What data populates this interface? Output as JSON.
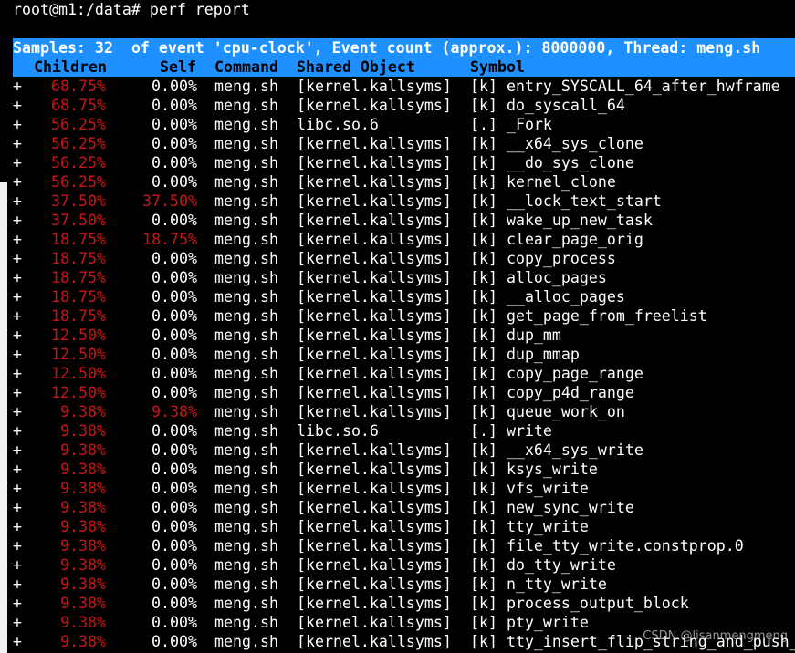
{
  "terminal": {
    "prompt": "root@m1:/data# perf report",
    "header_line": "Samples: 32  of event 'cpu-clock', Event count (approx.): 8000000, Thread: meng.sh",
    "columns": {
      "children": "Children",
      "self": "Self",
      "command": "Command",
      "shared_object": "Shared Object",
      "symbol": "Symbol"
    },
    "colors": {
      "header_bg": "#1e90ff",
      "hot_percent": "#cc1414",
      "background": "#000000",
      "text": "#ffffff"
    }
  },
  "rows": [
    {
      "plus": "+",
      "children": "68.75%",
      "self": "0.00%",
      "command": "meng.sh",
      "object": "[kernel.kallsyms]",
      "symbol": "[k] entry_SYSCALL_64_after_hwframe",
      "children_hot": true,
      "self_hot": false
    },
    {
      "plus": "+",
      "children": "68.75%",
      "self": "0.00%",
      "command": "meng.sh",
      "object": "[kernel.kallsyms]",
      "symbol": "[k] do_syscall_64",
      "children_hot": true,
      "self_hot": false
    },
    {
      "plus": "+",
      "children": "56.25%",
      "self": "0.00%",
      "command": "meng.sh",
      "object": "libc.so.6",
      "symbol": "[.] _Fork",
      "children_hot": true,
      "self_hot": false
    },
    {
      "plus": "+",
      "children": "56.25%",
      "self": "0.00%",
      "command": "meng.sh",
      "object": "[kernel.kallsyms]",
      "symbol": "[k] __x64_sys_clone",
      "children_hot": true,
      "self_hot": false
    },
    {
      "plus": "+",
      "children": "56.25%",
      "self": "0.00%",
      "command": "meng.sh",
      "object": "[kernel.kallsyms]",
      "symbol": "[k] __do_sys_clone",
      "children_hot": true,
      "self_hot": false
    },
    {
      "plus": "+",
      "children": "56.25%",
      "self": "0.00%",
      "command": "meng.sh",
      "object": "[kernel.kallsyms]",
      "symbol": "[k] kernel_clone",
      "children_hot": true,
      "self_hot": false
    },
    {
      "plus": "+",
      "children": "37.50%",
      "self": "37.50%",
      "command": "meng.sh",
      "object": "[kernel.kallsyms]",
      "symbol": "[k] __lock_text_start",
      "children_hot": true,
      "self_hot": true
    },
    {
      "plus": "+",
      "children": "37.50%",
      "self": "0.00%",
      "command": "meng.sh",
      "object": "[kernel.kallsyms]",
      "symbol": "[k] wake_up_new_task",
      "children_hot": true,
      "self_hot": false
    },
    {
      "plus": "+",
      "children": "18.75%",
      "self": "18.75%",
      "command": "meng.sh",
      "object": "[kernel.kallsyms]",
      "symbol": "[k] clear_page_orig",
      "children_hot": true,
      "self_hot": true
    },
    {
      "plus": "+",
      "children": "18.75%",
      "self": "0.00%",
      "command": "meng.sh",
      "object": "[kernel.kallsyms]",
      "symbol": "[k] copy_process",
      "children_hot": true,
      "self_hot": false
    },
    {
      "plus": "+",
      "children": "18.75%",
      "self": "0.00%",
      "command": "meng.sh",
      "object": "[kernel.kallsyms]",
      "symbol": "[k] alloc_pages",
      "children_hot": true,
      "self_hot": false
    },
    {
      "plus": "+",
      "children": "18.75%",
      "self": "0.00%",
      "command": "meng.sh",
      "object": "[kernel.kallsyms]",
      "symbol": "[k] __alloc_pages",
      "children_hot": true,
      "self_hot": false
    },
    {
      "plus": "+",
      "children": "18.75%",
      "self": "0.00%",
      "command": "meng.sh",
      "object": "[kernel.kallsyms]",
      "symbol": "[k] get_page_from_freelist",
      "children_hot": true,
      "self_hot": false
    },
    {
      "plus": "+",
      "children": "12.50%",
      "self": "0.00%",
      "command": "meng.sh",
      "object": "[kernel.kallsyms]",
      "symbol": "[k] dup_mm",
      "children_hot": true,
      "self_hot": false
    },
    {
      "plus": "+",
      "children": "12.50%",
      "self": "0.00%",
      "command": "meng.sh",
      "object": "[kernel.kallsyms]",
      "symbol": "[k] dup_mmap",
      "children_hot": true,
      "self_hot": false
    },
    {
      "plus": "+",
      "children": "12.50%",
      "self": "0.00%",
      "command": "meng.sh",
      "object": "[kernel.kallsyms]",
      "symbol": "[k] copy_page_range",
      "children_hot": true,
      "self_hot": false
    },
    {
      "plus": "+",
      "children": "12.50%",
      "self": "0.00%",
      "command": "meng.sh",
      "object": "[kernel.kallsyms]",
      "symbol": "[k] copy_p4d_range",
      "children_hot": true,
      "self_hot": false
    },
    {
      "plus": "+",
      "children": "9.38%",
      "self": "9.38%",
      "command": "meng.sh",
      "object": "[kernel.kallsyms]",
      "symbol": "[k] queue_work_on",
      "children_hot": true,
      "self_hot": true
    },
    {
      "plus": "+",
      "children": "9.38%",
      "self": "0.00%",
      "command": "meng.sh",
      "object": "libc.so.6",
      "symbol": "[.] write",
      "children_hot": true,
      "self_hot": false
    },
    {
      "plus": "+",
      "children": "9.38%",
      "self": "0.00%",
      "command": "meng.sh",
      "object": "[kernel.kallsyms]",
      "symbol": "[k] __x64_sys_write",
      "children_hot": true,
      "self_hot": false
    },
    {
      "plus": "+",
      "children": "9.38%",
      "self": "0.00%",
      "command": "meng.sh",
      "object": "[kernel.kallsyms]",
      "symbol": "[k] ksys_write",
      "children_hot": true,
      "self_hot": false
    },
    {
      "plus": "+",
      "children": "9.38%",
      "self": "0.00%",
      "command": "meng.sh",
      "object": "[kernel.kallsyms]",
      "symbol": "[k] vfs_write",
      "children_hot": true,
      "self_hot": false
    },
    {
      "plus": "+",
      "children": "9.38%",
      "self": "0.00%",
      "command": "meng.sh",
      "object": "[kernel.kallsyms]",
      "symbol": "[k] new_sync_write",
      "children_hot": true,
      "self_hot": false
    },
    {
      "plus": "+",
      "children": "9.38%",
      "self": "0.00%",
      "command": "meng.sh",
      "object": "[kernel.kallsyms]",
      "symbol": "[k] tty_write",
      "children_hot": true,
      "self_hot": false
    },
    {
      "plus": "+",
      "children": "9.38%",
      "self": "0.00%",
      "command": "meng.sh",
      "object": "[kernel.kallsyms]",
      "symbol": "[k] file_tty_write.constprop.0",
      "children_hot": true,
      "self_hot": false
    },
    {
      "plus": "+",
      "children": "9.38%",
      "self": "0.00%",
      "command": "meng.sh",
      "object": "[kernel.kallsyms]",
      "symbol": "[k] do_tty_write",
      "children_hot": true,
      "self_hot": false
    },
    {
      "plus": "+",
      "children": "9.38%",
      "self": "0.00%",
      "command": "meng.sh",
      "object": "[kernel.kallsyms]",
      "symbol": "[k] n_tty_write",
      "children_hot": true,
      "self_hot": false
    },
    {
      "plus": "+",
      "children": "9.38%",
      "self": "0.00%",
      "command": "meng.sh",
      "object": "[kernel.kallsyms]",
      "symbol": "[k] process_output_block",
      "children_hot": true,
      "self_hot": false
    },
    {
      "plus": "+",
      "children": "9.38%",
      "self": "0.00%",
      "command": "meng.sh",
      "object": "[kernel.kallsyms]",
      "symbol": "[k] pty_write",
      "children_hot": true,
      "self_hot": false
    },
    {
      "plus": "+",
      "children": "9.38%",
      "self": "0.00%",
      "command": "meng.sh",
      "object": "[kernel.kallsyms]",
      "symbol": "[k] tty_insert_flip_string_and_push_",
      "children_hot": true,
      "self_hot": false
    }
  ],
  "watermark": "CSDN @lisanmengmeng"
}
